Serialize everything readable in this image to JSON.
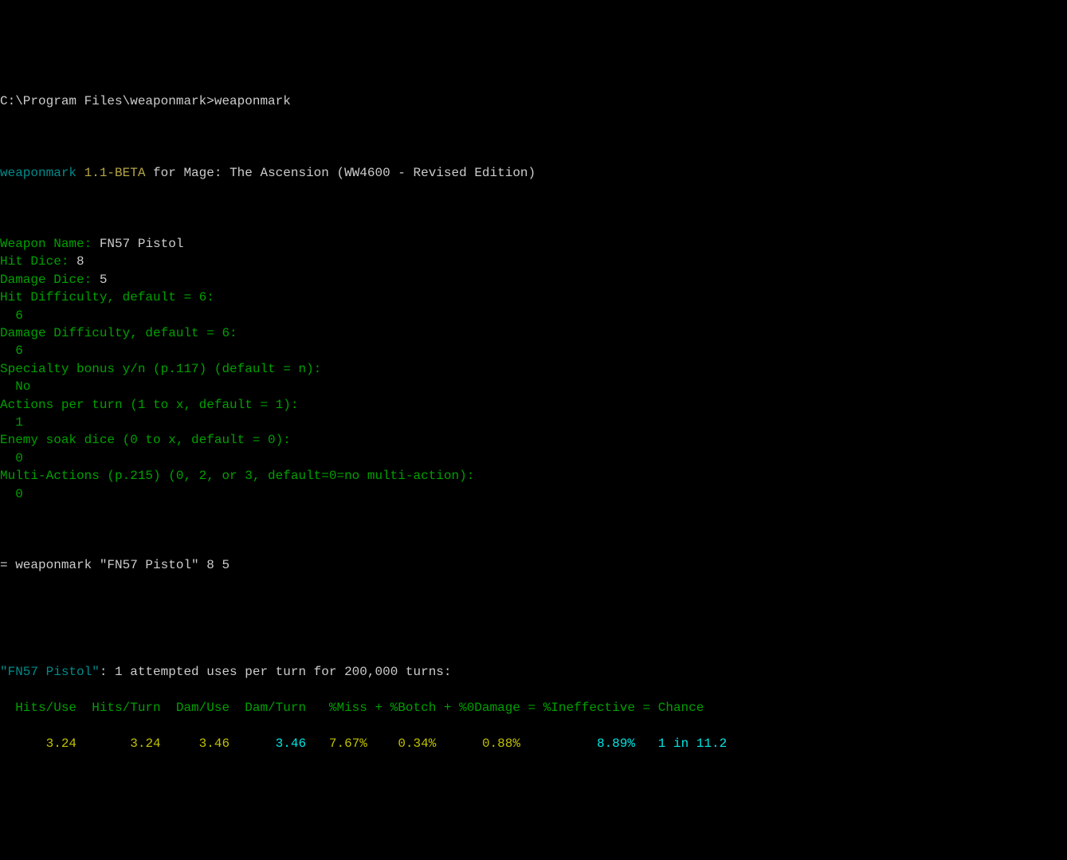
{
  "prompt_line": {
    "path": "C:\\Program Files\\weaponmark>",
    "command": "weaponmark"
  },
  "header": {
    "app_name": "weaponmark",
    "version": "1.1-BETA",
    "tagline": "for Mage: The Ascension (WW4600 - Revised Edition)"
  },
  "inputs": [
    {
      "label": "Weapon Name:",
      "value": "FN57 Pistol",
      "inline": true,
      "value_color": "white"
    },
    {
      "label": "Hit Dice:",
      "value": "8",
      "inline": true,
      "value_color": "white"
    },
    {
      "label": "Damage Dice:",
      "value": "5",
      "inline": true,
      "value_color": "white"
    },
    {
      "label": "Hit Difficulty, default = 6:",
      "value": "6",
      "inline": false,
      "value_color": "green"
    },
    {
      "label": "Damage Difficulty, default = 6:",
      "value": "6",
      "inline": false,
      "value_color": "green"
    },
    {
      "label": "Specialty bonus y/n (p.117) (default = n):",
      "value": "No",
      "inline": false,
      "value_color": "green"
    },
    {
      "label": "Actions per turn (1 to x, default = 1):",
      "value": "1",
      "inline": false,
      "value_color": "green"
    },
    {
      "label": "Enemy soak dice (0 to x, default = 0):",
      "value": "0",
      "inline": false,
      "value_color": "green"
    },
    {
      "label": "Multi-Actions (p.215) (0, 2, or 3, default=0=no multi-action):",
      "value": "0",
      "inline": false,
      "value_color": "green"
    }
  ],
  "command_echo": "= weaponmark \"FN57 Pistol\" 8 5",
  "result": {
    "name_quoted": "\"FN57 Pistol\"",
    "summary": ": 1 attempted uses per turn for 200,000 turns:",
    "headers": "  Hits/Use  Hits/Turn  Dam/Use  Dam/Turn   %Miss + %Botch + %0Damage = %Ineffective = Chance",
    "values": {
      "hits_use": "3.24",
      "hits_turn": "3.24",
      "dam_use": "3.46",
      "dam_turn": "3.46",
      "miss": "7.67%",
      "botch": "0.34%",
      "zero_damage": "0.88%",
      "ineffective": "8.89%",
      "chance": "1 in 11.2"
    }
  }
}
